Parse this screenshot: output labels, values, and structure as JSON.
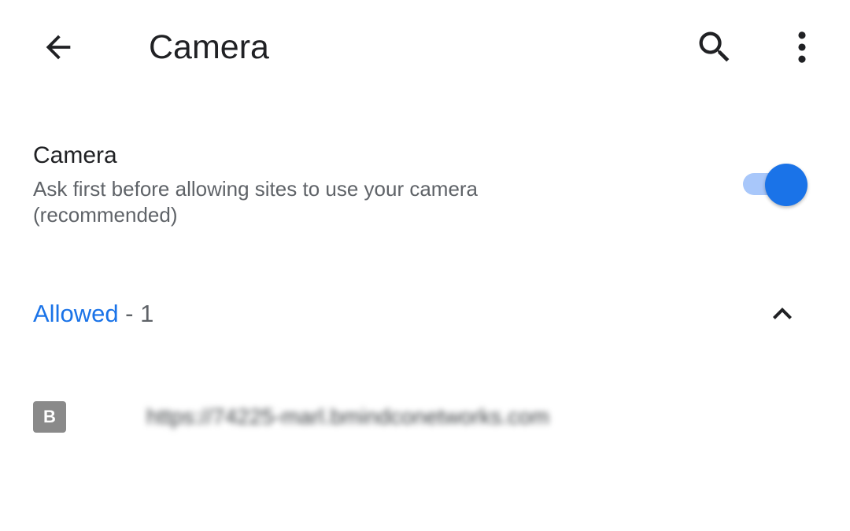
{
  "appbar": {
    "title": "Camera",
    "icons": {
      "back": "arrow-back-icon",
      "search": "search-icon",
      "more": "more-vert-icon"
    }
  },
  "setting": {
    "title": "Camera",
    "summary": "Ask first before allowing sites to use your camera (recommended)",
    "toggle_on": true,
    "accent_color": "#1a73e8"
  },
  "section": {
    "label": "Allowed",
    "count": " - 1",
    "expanded": true,
    "icon": "chevron-up-icon"
  },
  "sites": [
    {
      "favicon_letter": "B",
      "url": "https://74225-marl.bmindconetworks.com"
    }
  ]
}
